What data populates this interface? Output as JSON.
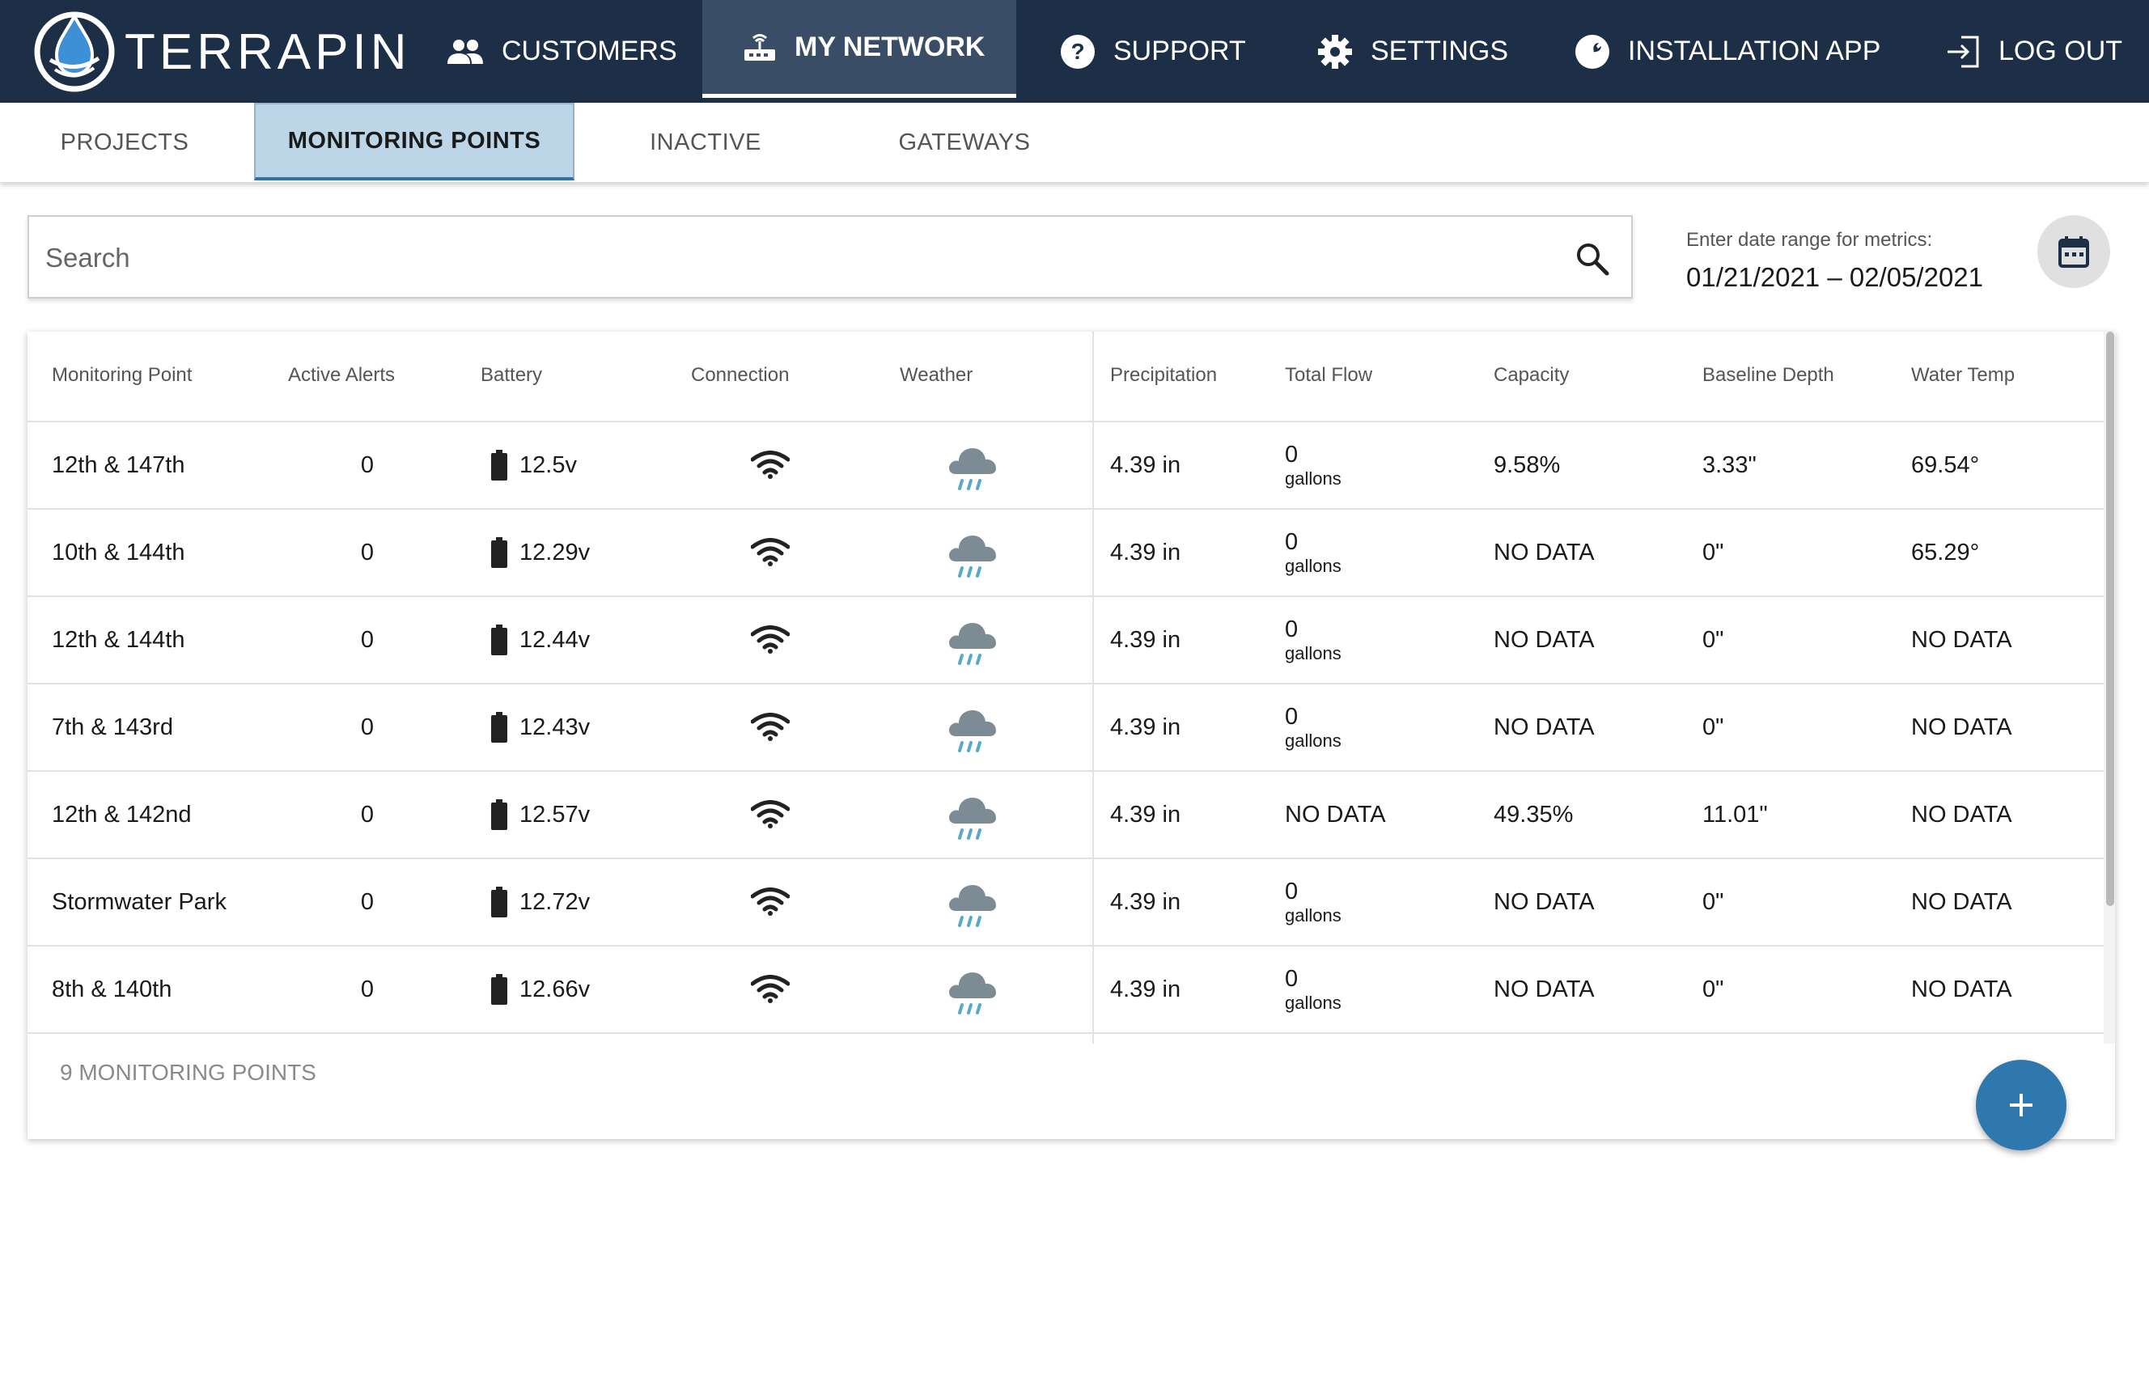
{
  "header": {
    "brand": "TERRAPIN",
    "nav": [
      {
        "label": "CUSTOMERS",
        "icon": "people-icon"
      },
      {
        "label": "MY NETWORK",
        "icon": "router-icon",
        "active": true
      },
      {
        "label": "SUPPORT",
        "icon": "help-circle-icon"
      },
      {
        "label": "SETTINGS",
        "icon": "gear-icon"
      },
      {
        "label": "INSTALLATION APP",
        "icon": "wrench-icon"
      },
      {
        "label": "LOG OUT",
        "icon": "logout-icon"
      }
    ]
  },
  "tabs": [
    {
      "label": "PROJECTS"
    },
    {
      "label": "MONITORING POINTS",
      "active": true
    },
    {
      "label": "INACTIVE"
    },
    {
      "label": "GATEWAYS"
    }
  ],
  "search": {
    "placeholder": "Search"
  },
  "date_range": {
    "label": "Enter date range for metrics:",
    "value": "01/21/2021 – 02/05/2021"
  },
  "table": {
    "columns": [
      "Monitoring Point",
      "Active Alerts",
      "Battery",
      "Connection",
      "Weather",
      "Precipitation",
      "Total Flow",
      "Capacity",
      "Baseline Depth",
      "Water Temp"
    ],
    "rows": [
      {
        "name": "12th & 147th",
        "alerts": "0",
        "battery": "12.5v",
        "connection": "wifi-icon",
        "weather": "rain-cloud-icon",
        "precip": "4.39 in",
        "flow_value": "0",
        "flow_unit": "gallons",
        "capacity": "9.58%",
        "depth": "3.33\"",
        "temp": "69.54°"
      },
      {
        "name": "10th & 144th",
        "alerts": "0",
        "battery": "12.29v",
        "connection": "wifi-icon",
        "weather": "rain-cloud-icon",
        "precip": "4.39 in",
        "flow_value": "0",
        "flow_unit": "gallons",
        "capacity": "NO DATA",
        "depth": "0\"",
        "temp": "65.29°"
      },
      {
        "name": "12th & 144th",
        "alerts": "0",
        "battery": "12.44v",
        "connection": "wifi-icon",
        "weather": "rain-cloud-icon",
        "precip": "4.39 in",
        "flow_value": "0",
        "flow_unit": "gallons",
        "capacity": "NO DATA",
        "depth": "0\"",
        "temp": "NO DATA"
      },
      {
        "name": "7th & 143rd",
        "alerts": "0",
        "battery": "12.43v",
        "connection": "wifi-icon",
        "weather": "rain-cloud-icon",
        "precip": "4.39 in",
        "flow_value": "0",
        "flow_unit": "gallons",
        "capacity": "NO DATA",
        "depth": "0\"",
        "temp": "NO DATA"
      },
      {
        "name": "12th & 142nd",
        "alerts": "0",
        "battery": "12.57v",
        "connection": "wifi-icon",
        "weather": "rain-cloud-icon",
        "precip": "4.39 in",
        "flow_value": "NO DATA",
        "flow_unit": "",
        "capacity": "49.35%",
        "depth": "11.01\"",
        "temp": "NO DATA"
      },
      {
        "name": "Stormwater Park",
        "alerts": "0",
        "battery": "12.72v",
        "connection": "wifi-icon",
        "weather": "rain-cloud-icon",
        "precip": "4.39 in",
        "flow_value": "0",
        "flow_unit": "gallons",
        "capacity": "NO DATA",
        "depth": "0\"",
        "temp": "NO DATA"
      },
      {
        "name": "8th & 140th",
        "alerts": "0",
        "battery": "12.66v",
        "connection": "wifi-icon",
        "weather": "rain-cloud-icon",
        "precip": "4.39 in",
        "flow_value": "0",
        "flow_unit": "gallons",
        "capacity": "NO DATA",
        "depth": "0\"",
        "temp": "NO DATA"
      }
    ]
  },
  "footer": {
    "count_label": "9 MONITORING POINTS"
  },
  "fab": {
    "icon": "plus-icon"
  },
  "colors": {
    "header_bg": "#1d2f47",
    "active_nav": "#3a4d66",
    "active_tab": "#bcd6e8",
    "accent": "#2f78ae",
    "rain": "#5aa9c9",
    "cloud": "#7d8c94"
  }
}
